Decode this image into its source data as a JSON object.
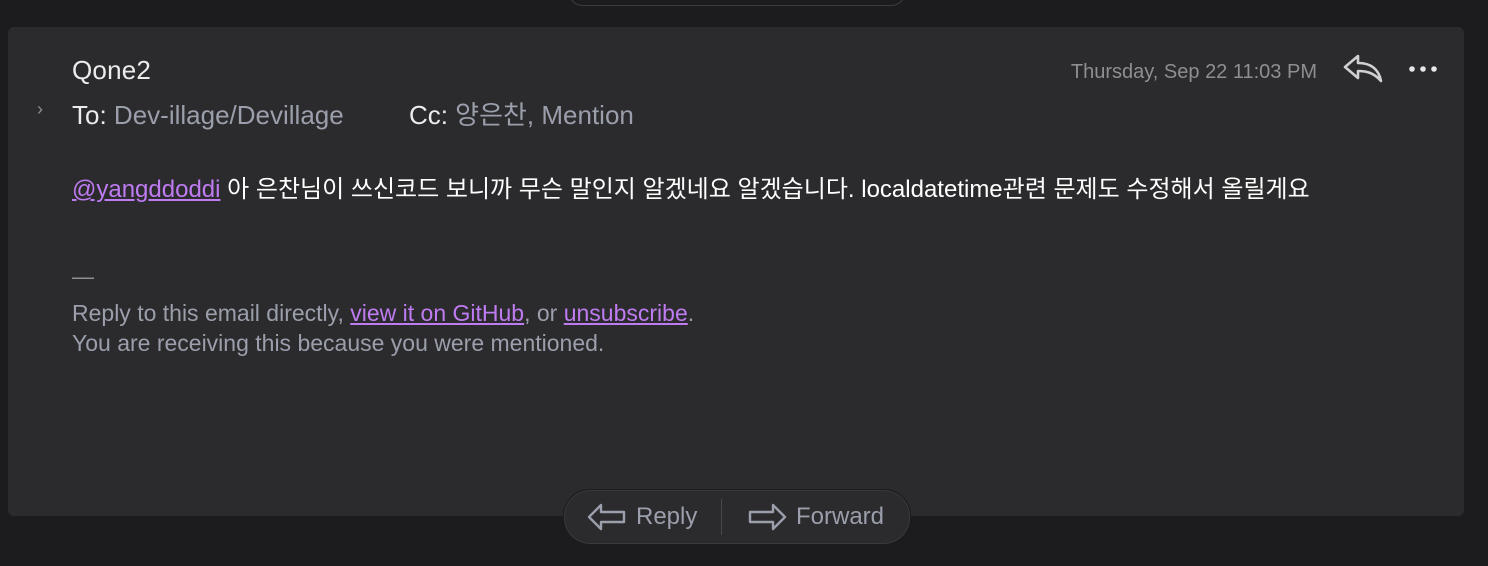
{
  "message": {
    "sender": "Qone2",
    "to_label": "To:",
    "to_value": "Dev-illage/Devillage",
    "cc_label": "Cc:",
    "cc_value": "양은찬, Mention",
    "timestamp": "Thursday, Sep 22 11:03 PM",
    "body": {
      "mention": "@yangddoddi",
      "text": " 아 은찬님이 쓰신코드 보니까 무슨 말인지 알겠네요 알겠습니다. localdatetime관련 문제도 수정해서 올릴게요"
    },
    "signature_dash": "—",
    "footer": {
      "line1_prefix": "Reply to this email directly, ",
      "link_github": "view it on GitHub",
      "line1_mid": ", or ",
      "link_unsubscribe": "unsubscribe",
      "line1_suffix": ".",
      "line2": "You are receiving this because you were mentioned."
    }
  },
  "actions": {
    "reply_label": "Reply",
    "forward_label": "Forward"
  },
  "icons": {
    "chevron": "chevron-right-icon",
    "reply": "reply-arrow-icon",
    "more": "more-horizontal-icon",
    "forward": "forward-arrow-icon"
  },
  "colors": {
    "background": "#1c1c1e",
    "card": "#2b2b2d",
    "link": "#bf7bf2",
    "muted": "#9b9eab"
  }
}
